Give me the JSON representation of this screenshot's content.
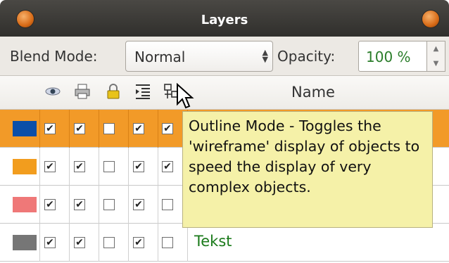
{
  "window": {
    "title": "Layers"
  },
  "controls": {
    "blend_label": "Blend Mode:",
    "blend_value": "Normal",
    "opacity_label": "Opacity:",
    "opacity_value": "100 %"
  },
  "header": {
    "name_label": "Name",
    "icons": [
      "eye-icon",
      "printer-icon",
      "lock-icon",
      "indent-icon",
      "outline-mode-icon"
    ]
  },
  "rows": [
    {
      "color": "#0b4fa8",
      "checks": [
        true,
        true,
        false,
        true,
        true
      ],
      "name": "",
      "selected": true
    },
    {
      "color": "#f29d1e",
      "checks": [
        true,
        true,
        false,
        true,
        true
      ],
      "name": "",
      "selected": false
    },
    {
      "color": "#ef7878",
      "checks": [
        true,
        true,
        false,
        true,
        false
      ],
      "name": "",
      "selected": false
    },
    {
      "color": "#767676",
      "checks": [
        true,
        true,
        false,
        true,
        false
      ],
      "name": "Tekst",
      "selected": false
    }
  ],
  "tooltip": {
    "text": "Outline Mode - Toggles the 'wireframe' display of objects to speed the display of very complex objects."
  }
}
